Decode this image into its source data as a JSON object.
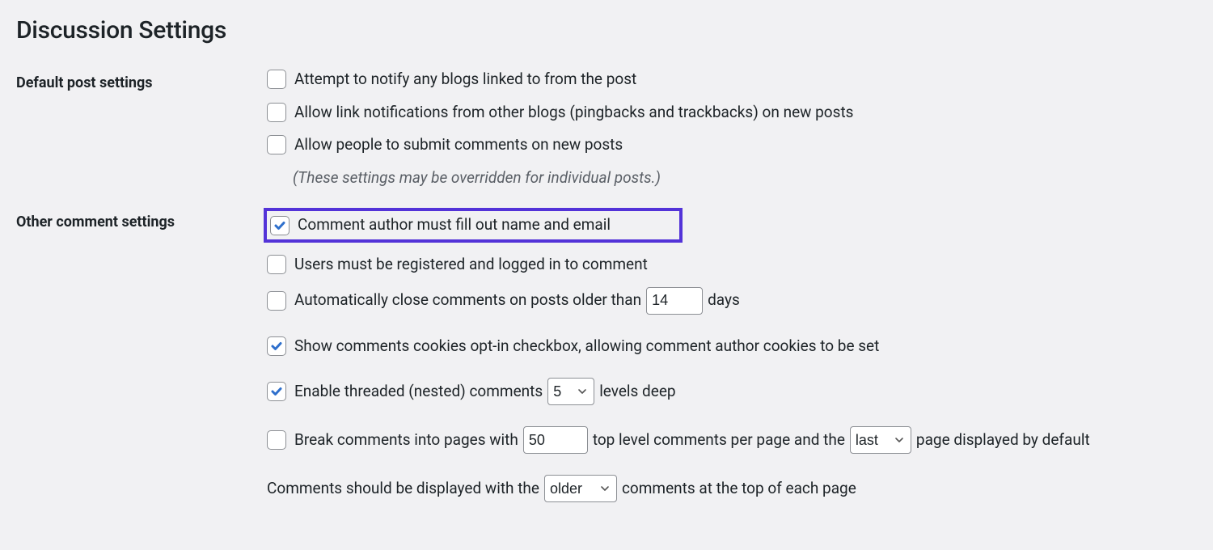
{
  "page_title": "Discussion Settings",
  "sections": {
    "default_post": {
      "heading": "Default post settings",
      "notify_blogs": {
        "label": "Attempt to notify any blogs linked to from the post",
        "checked": false
      },
      "allow_pingbacks": {
        "label": "Allow link notifications from other blogs (pingbacks and trackbacks) on new posts",
        "checked": false
      },
      "allow_comments": {
        "label": "Allow people to submit comments on new posts",
        "checked": false
      },
      "override_hint": "(These settings may be overridden for individual posts.)"
    },
    "other_comment": {
      "heading": "Other comment settings",
      "require_name_email": {
        "label": "Comment author must fill out name and email",
        "checked": true
      },
      "require_registered": {
        "label": "Users must be registered and logged in to comment",
        "checked": false
      },
      "auto_close": {
        "label_pre": "Automatically close comments on posts older than",
        "value": "14",
        "label_post": "days",
        "checked": false
      },
      "cookies_optin": {
        "label": "Show comments cookies opt-in checkbox, allowing comment author cookies to be set",
        "checked": true
      },
      "threaded": {
        "label_pre": "Enable threaded (nested) comments",
        "value": "5",
        "label_post": "levels deep",
        "checked": true
      },
      "paginate": {
        "label_pre": "Break comments into pages with",
        "per_page": "50",
        "label_mid": "top level comments per page and the",
        "default_page": "last",
        "label_post": "page displayed by default",
        "checked": false
      },
      "order": {
        "label_pre": "Comments should be displayed with the",
        "value": "older",
        "label_post": "comments at the top of each page"
      }
    }
  }
}
